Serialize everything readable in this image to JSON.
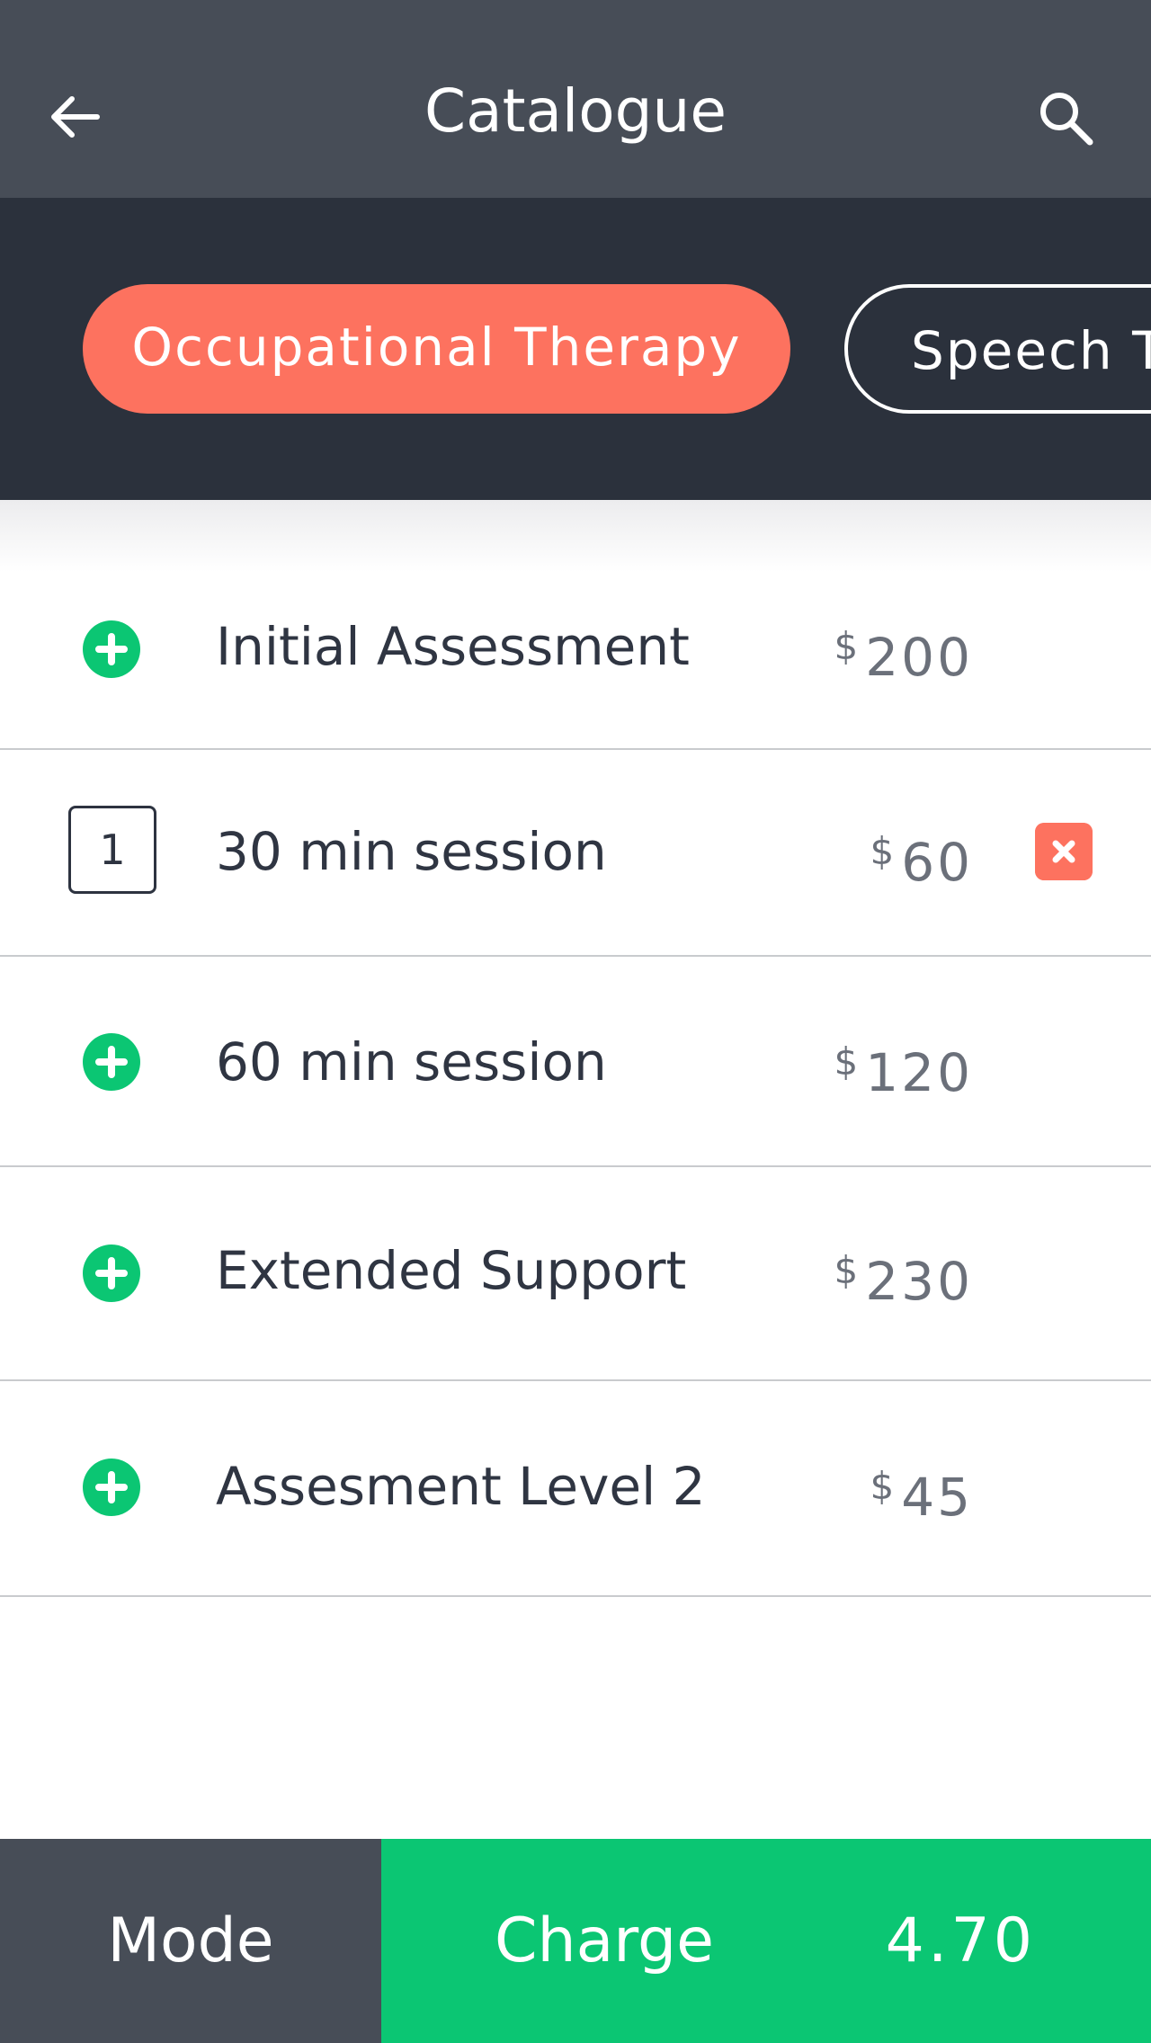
{
  "header": {
    "title": "Catalogue",
    "back_icon": "arrow-left-icon",
    "search_icon": "search-icon",
    "background": "#474d57"
  },
  "categories": {
    "active": "Occupational Therapy",
    "inactive": "Speech T"
  },
  "items": [
    {
      "name": "Initial Assessment",
      "currency": "$",
      "price": "200",
      "selected": false
    },
    {
      "name": "30 min session",
      "currency": "$",
      "price": "60",
      "selected": true,
      "quantity": "1"
    },
    {
      "name": "60 min session",
      "currency": "$",
      "price": "120",
      "selected": false
    },
    {
      "name": "Extended Support",
      "currency": "$",
      "price": "230",
      "selected": false
    },
    {
      "name": "Assesment Level 2",
      "currency": "$",
      "price": "45",
      "selected": false
    }
  ],
  "footer": {
    "mode_label": "Mode",
    "charge_label": "Charge",
    "charge_amount": "4.70"
  },
  "colors": {
    "accent": "#fd725f",
    "success": "#0bc673",
    "dark": "#2b313c",
    "header": "#474d57"
  }
}
